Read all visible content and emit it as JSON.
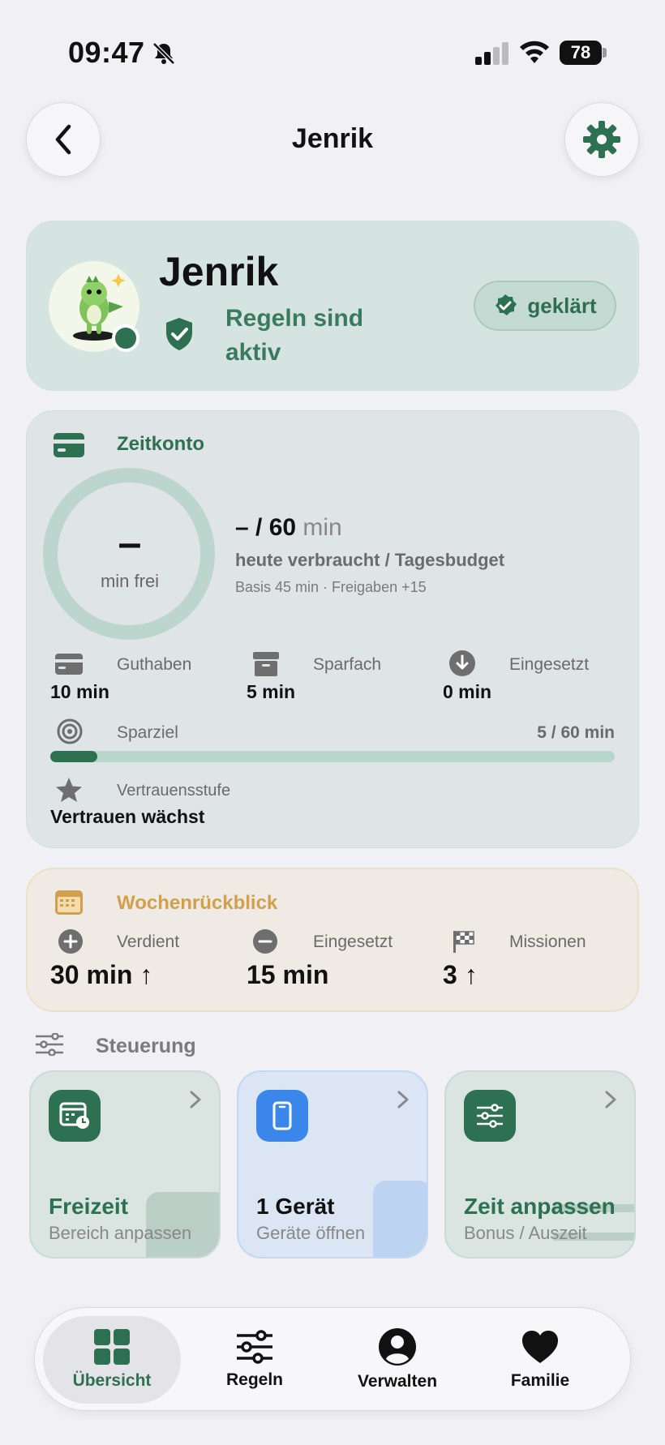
{
  "status_bar": {
    "time": "09:47",
    "battery": "78"
  },
  "header": {
    "title": "Jenrik"
  },
  "profile": {
    "name": "Jenrik",
    "rules_status": "Regeln sind aktiv",
    "badge": "geklärt"
  },
  "zeitkonto": {
    "title": "Zeitkonto",
    "ring_value": "–",
    "ring_label": "min frei",
    "budget_value": "– / 60",
    "budget_unit": "min",
    "budget_caption": "heute verbraucht / Tagesbudget",
    "budget_detail": "Basis 45 min · Freigaben +15",
    "stats": [
      {
        "label": "Guthaben",
        "value": "10 min"
      },
      {
        "label": "Sparfach",
        "value": "5 min"
      },
      {
        "label": "Eingesetzt",
        "value": "0 min"
      }
    ],
    "goal": {
      "label": "Sparziel",
      "value": "5 / 60 min",
      "progress": 0.083
    },
    "trust": {
      "label": "Vertrauensstufe",
      "value": "Vertrauen wächst"
    }
  },
  "wochenrueckblick": {
    "title": "Wochenrückblick",
    "stats": [
      {
        "label": "Verdient",
        "value": "30 min ↑"
      },
      {
        "label": "Eingesetzt",
        "value": "15 min"
      },
      {
        "label": "Missionen",
        "value": "3 ↑"
      }
    ]
  },
  "steuerung": {
    "label": "Steuerung",
    "tiles": [
      {
        "title": "Freizeit",
        "subtitle": "Bereich anpassen",
        "icon": "calendar-clock-icon"
      },
      {
        "title": "1 Gerät",
        "subtitle": "Geräte öffnen",
        "icon": "phone-icon"
      },
      {
        "title": "Zeit anpassen",
        "subtitle": "Bonus / Auszeit",
        "icon": "sliders-icon"
      }
    ]
  },
  "tabbar": {
    "tabs": [
      {
        "label": "Übersicht",
        "icon": "grid-icon"
      },
      {
        "label": "Regeln",
        "icon": "sliders-icon"
      },
      {
        "label": "Verwalten",
        "icon": "person-icon"
      },
      {
        "label": "Familie",
        "icon": "heart-icon"
      }
    ],
    "active": "Übersicht"
  },
  "colors": {
    "accent": "#2e7052",
    "accent_light": "#3a7a5e",
    "warm": "#d1a04c",
    "blue": "#3b86ea"
  }
}
